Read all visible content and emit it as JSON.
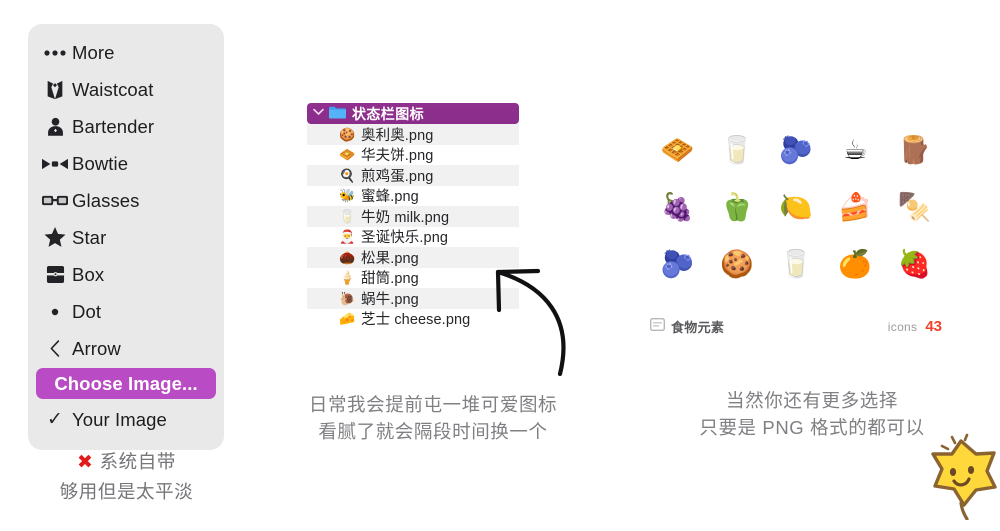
{
  "menu": {
    "items": [
      {
        "icon": "ellipsis-icon",
        "label": "More"
      },
      {
        "icon": "waistcoat-icon",
        "label": "Waistcoat"
      },
      {
        "icon": "bartender-icon",
        "label": "Bartender"
      },
      {
        "icon": "bowtie-icon",
        "label": "Bowtie"
      },
      {
        "icon": "glasses-icon",
        "label": "Glasses"
      },
      {
        "icon": "star-icon",
        "label": "Star"
      },
      {
        "icon": "box-icon",
        "label": "Box"
      },
      {
        "icon": "dot-icon",
        "label": "Dot"
      },
      {
        "icon": "arrow-left-icon",
        "label": "Arrow"
      }
    ],
    "choose_image": {
      "label": "Choose Image...",
      "highlight_color": "#b94cc4"
    },
    "your_image": {
      "label": "Your Image",
      "check": "✓"
    }
  },
  "file_list": {
    "header": {
      "chevron": "⌄",
      "title": "状态栏图标",
      "bg_color": "#8f2f8f"
    },
    "files": [
      {
        "emoji": "🍪",
        "name": "奥利奥.png"
      },
      {
        "emoji": "🧇",
        "name": "华夫饼.png"
      },
      {
        "emoji": "🍳",
        "name": "煎鸡蛋.png"
      },
      {
        "emoji": "🐝",
        "name": "蜜蜂.png"
      },
      {
        "emoji": "🥛",
        "name": "牛奶 milk.png"
      },
      {
        "emoji": "🎅",
        "name": "圣诞快乐.png"
      },
      {
        "emoji": "🌰",
        "name": "松果.png"
      },
      {
        "emoji": "🍦",
        "name": "甜筒.png"
      },
      {
        "emoji": "🐌",
        "name": "蜗牛.png"
      },
      {
        "emoji": "🧀",
        "name": "芝士 cheese.png"
      }
    ]
  },
  "icon_grid": {
    "icons": [
      {
        "name": "waffle-icon",
        "emoji": "🧇"
      },
      {
        "name": "milk-glass-icon",
        "emoji": "🥛"
      },
      {
        "name": "plum-icon",
        "emoji": "🫐"
      },
      {
        "name": "coffee-cup-icon",
        "emoji": "☕"
      },
      {
        "name": "cinnamon-stick-icon",
        "emoji": "🪵"
      },
      {
        "name": "grapes-icon",
        "emoji": "🍇"
      },
      {
        "name": "bell-pepper-icon",
        "emoji": "🫑"
      },
      {
        "name": "lemon-icon",
        "emoji": "🍋"
      },
      {
        "name": "cake-slice-icon",
        "emoji": "🍰"
      },
      {
        "name": "cotton-candy-icon",
        "emoji": "🍢"
      },
      {
        "name": "mangosteen-icon",
        "emoji": "🫐"
      },
      {
        "name": "cookie-icon",
        "emoji": "🍪"
      },
      {
        "name": "water-glass-icon",
        "emoji": "🥛"
      },
      {
        "name": "orange-icon",
        "emoji": "🍊"
      },
      {
        "name": "strawberry-icon",
        "emoji": "🍓"
      }
    ],
    "footer": {
      "category": "食物元素",
      "count_word": "icons",
      "count_value": "43",
      "count_color": "#f0432a"
    }
  },
  "captions": {
    "left": {
      "mark": "✖",
      "line1": "系统自带",
      "line2": "够用但是太平淡",
      "mark_color": "#e01b1b"
    },
    "middle": {
      "line1": "日常我会提前屯一堆可爱图标",
      "line2": "看腻了就会隔段时间换一个"
    },
    "right": {
      "line1": "当然你还有更多选择",
      "line2": "只要是 PNG 格式的都可以"
    }
  },
  "decorations": {
    "curved_arrow": "curved-arrow-up-left",
    "star_sticker": "smiling-star-sticker"
  }
}
